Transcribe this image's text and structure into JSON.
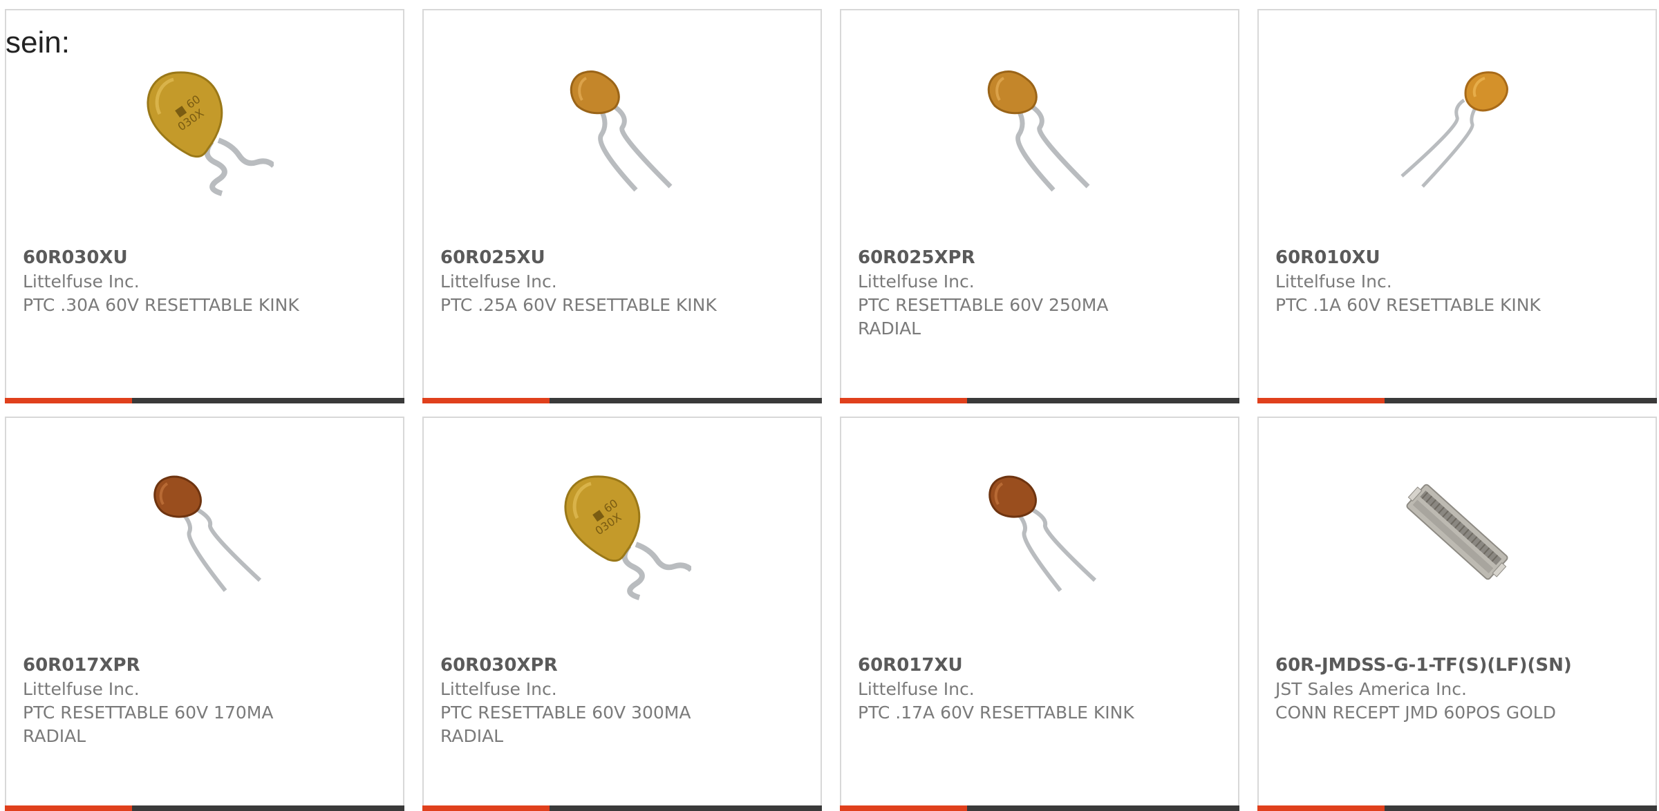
{
  "lead": "sein:",
  "colors": {
    "accent": "#e0401c",
    "bar": "#3a3a3a",
    "border": "#d8d8d8",
    "part_text": "#5a5a5a",
    "meta_text": "#7a7a7a"
  },
  "cards": [
    {
      "part": "60R030XU",
      "maker": "Littelfuse Inc.",
      "desc": "PTC .30A 60V RESETTABLE KINK",
      "icon": "ptc-disc-large-icon"
    },
    {
      "part": "60R025XU",
      "maker": "Littelfuse Inc.",
      "desc": "PTC .25A 60V RESETTABLE KINK",
      "icon": "ptc-radial-small-icon"
    },
    {
      "part": "60R025XPR",
      "maker": "Littelfuse Inc.",
      "desc": "PTC RESETTABLE 60V 250MA RADIAL",
      "icon": "ptc-radial-small-icon"
    },
    {
      "part": "60R010XU",
      "maker": "Littelfuse Inc.",
      "desc": "PTC .1A 60V RESETTABLE KINK",
      "icon": "ptc-radial-tilted-icon"
    },
    {
      "part": "60R017XPR",
      "maker": "Littelfuse Inc.",
      "desc": "PTC RESETTABLE 60V 170MA RADIAL",
      "icon": "ptc-radial-dark-icon"
    },
    {
      "part": "60R030XPR",
      "maker": "Littelfuse Inc.",
      "desc": "PTC RESETTABLE 60V 300MA RADIAL",
      "icon": "ptc-disc-large-icon"
    },
    {
      "part": "60R017XU",
      "maker": "Littelfuse Inc.",
      "desc": "PTC .17A 60V RESETTABLE KINK",
      "icon": "ptc-radial-dark-icon"
    },
    {
      "part": "60R-JMDSS-G-1-TF(S)(LF)(SN)",
      "maker": "JST Sales America Inc.",
      "desc": "CONN RECEPT JMD 60POS GOLD",
      "icon": "connector-icon"
    }
  ]
}
